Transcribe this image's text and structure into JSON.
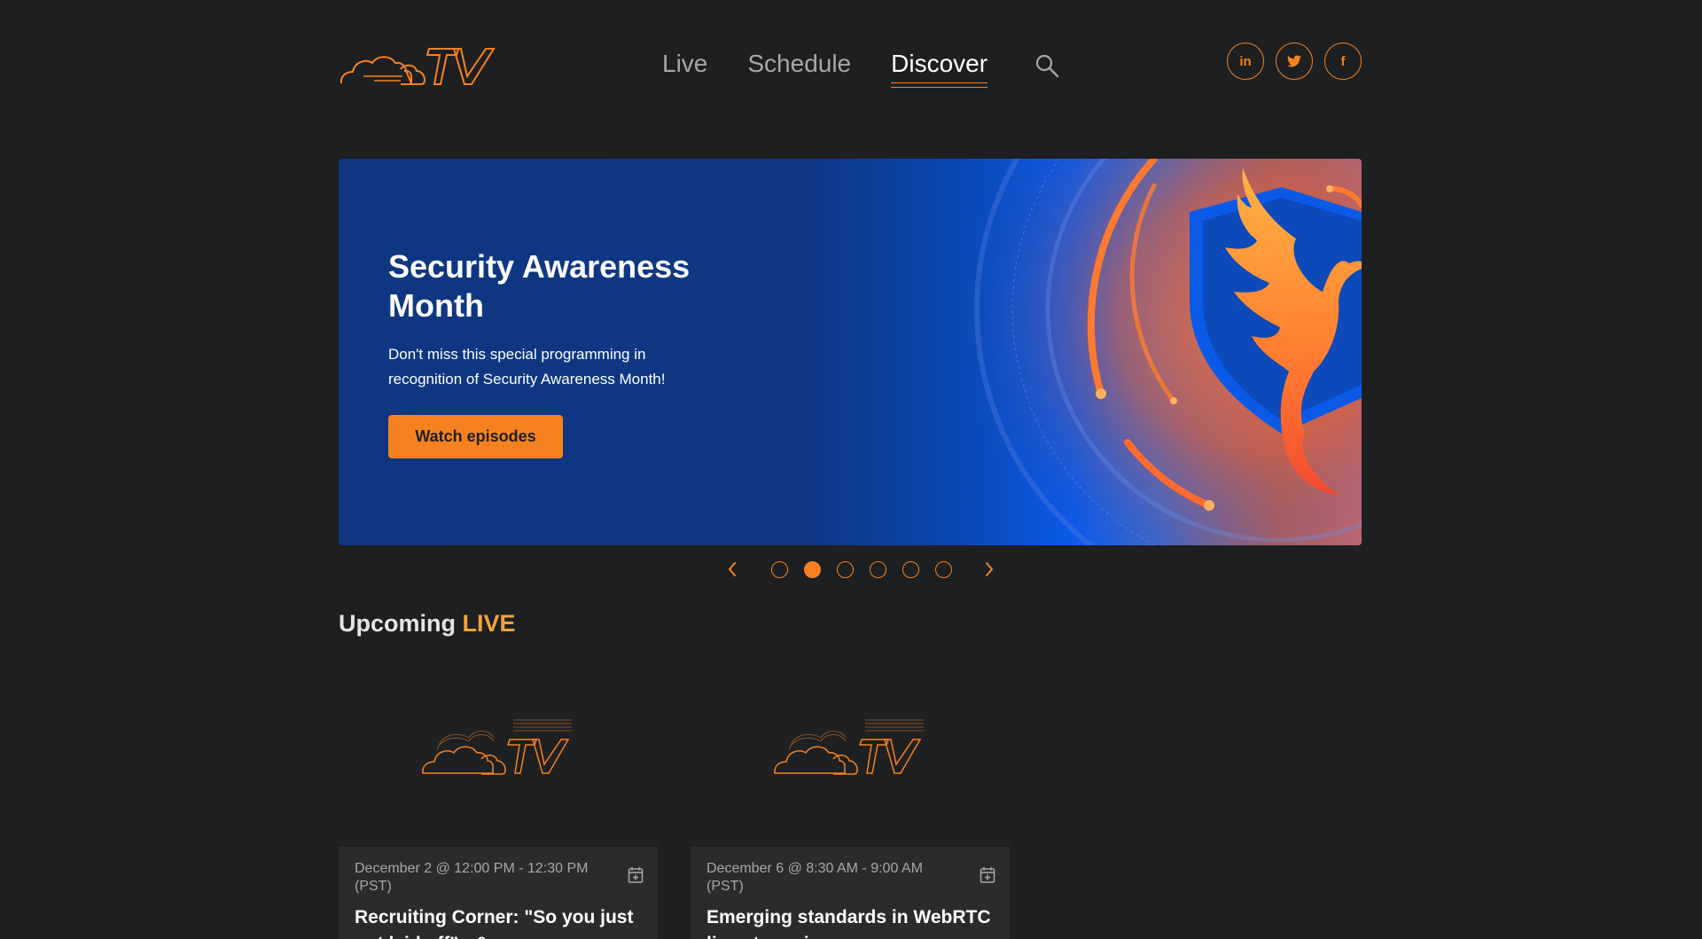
{
  "header": {
    "logo": "Cloudflare TV",
    "nav": [
      {
        "label": "Live",
        "active": false
      },
      {
        "label": "Schedule",
        "active": false
      },
      {
        "label": "Discover",
        "active": true
      }
    ],
    "socials": [
      {
        "icon": "linkedin-icon",
        "glyph": "in"
      },
      {
        "icon": "twitter-icon"
      },
      {
        "icon": "facebook-icon",
        "glyph": "f"
      }
    ]
  },
  "hero": {
    "title": "Security Awareness Month",
    "description": "Don't miss this special programming in recognition of Security Awareness Month!",
    "button_label": "Watch episodes",
    "total_slides": 6,
    "active_slide": 2
  },
  "section": {
    "title": "Upcoming",
    "title_accent": "LIVE"
  },
  "cards": [
    {
      "date": "December 2 @ 12:00 PM - 12:30 PM (PST)",
      "title": "Recruiting Corner: \"So you just got laid off\" - & ..."
    },
    {
      "date": "December 6 @ 8:30 AM - 9:00 AM (PST)",
      "title": "Emerging standards in WebRTC live streaming"
    }
  ],
  "colors": {
    "accent": "#f6821f",
    "background": "#1e1f21",
    "hero_blue": "#0f3680"
  }
}
